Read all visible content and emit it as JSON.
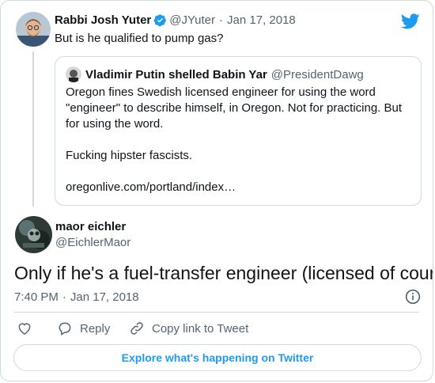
{
  "colors": {
    "accent": "#1d9bf0",
    "muted": "#536471",
    "border": "#cfd9de"
  },
  "parent_tweet": {
    "author_name": "Rabbi Josh Yuter",
    "handle": "@JYuter",
    "separator": "·",
    "date": "Jan 17, 2018",
    "text": "But is he qualified to pump gas?",
    "verified_icon": "verified-badge-icon"
  },
  "quoted_tweet": {
    "author_name": "Vladimir Putin shelled Babin Yar",
    "handle": "@PresidentDawg",
    "paragraphs": [
      "Oregon fines Swedish licensed engineer for using the word \"engineer\" to describe himself, in Oregon. Not for practicing. But for using the word.",
      "Fucking hipster fascists.",
      "oregonlive.com/portland/index…"
    ]
  },
  "main_tweet": {
    "author_name": "maor eichler",
    "handle": "@EichlerMaor",
    "text": "Only if he's a fuel-transfer engineer (licensed of course)",
    "time": "7:40 PM",
    "separator": "·",
    "date": "Jan 17, 2018"
  },
  "actions": {
    "reply_label": "Reply",
    "copy_link_label": "Copy link to Tweet"
  },
  "explore_label": "Explore what's happening on Twitter",
  "icons": [
    "twitter-logo-icon",
    "verified-badge-icon",
    "info-icon",
    "heart-icon",
    "reply-icon",
    "link-icon"
  ]
}
